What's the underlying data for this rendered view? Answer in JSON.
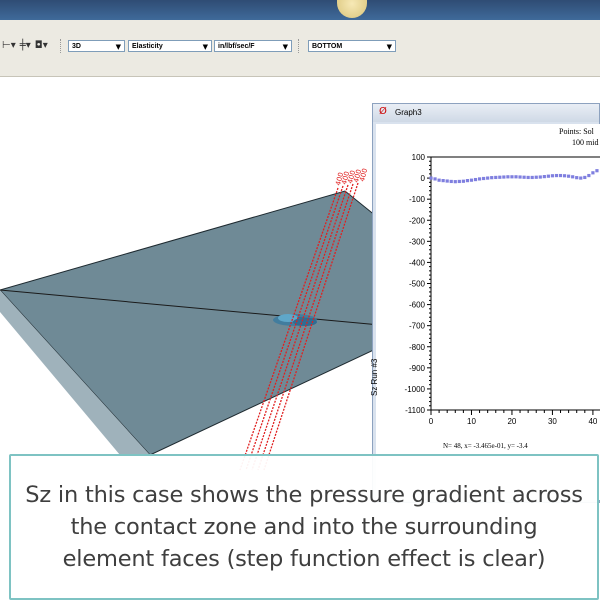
{
  "toolbar": {
    "view_mode": "3D",
    "result_type": "Elasticity",
    "units": "in/lbf/sec/F",
    "surface": "BOTTOM",
    "icons": [
      "lock-icon",
      "axis-icon",
      "camera-icon"
    ]
  },
  "graph_window": {
    "title": "Graph3",
    "info_line1": "Points: Sol",
    "info_line2": "100 mid",
    "stat_line": "N=   48, x= -3.465e-01, y= -3.4",
    "chart_data": {
      "type": "scatter",
      "ylabel": "Sz  Run #3",
      "xlabel": "",
      "y_ticks": [
        100,
        0,
        -100,
        -200,
        -300,
        -400,
        -500,
        -600,
        -700,
        -800,
        -900,
        -1000,
        -1100
      ],
      "x_ticks": [
        0,
        10,
        20,
        30,
        40
      ],
      "ylim": [
        -1100,
        100
      ],
      "xlim": [
        0,
        42
      ],
      "series": [
        {
          "color": "#7f7fdf",
          "points": [
            [
              0,
              0
            ],
            [
              1,
              -4
            ],
            [
              2,
              -10
            ],
            [
              3,
              -12
            ],
            [
              4,
              -14
            ],
            [
              5,
              -16
            ],
            [
              6,
              -17
            ],
            [
              7,
              -16
            ],
            [
              8,
              -15
            ],
            [
              9,
              -12
            ],
            [
              10,
              -10
            ],
            [
              11,
              -7
            ],
            [
              12,
              -4
            ],
            [
              13,
              -2
            ],
            [
              14,
              0
            ],
            [
              15,
              2
            ],
            [
              16,
              3
            ],
            [
              17,
              4
            ],
            [
              18,
              5
            ],
            [
              19,
              6
            ],
            [
              20,
              6
            ],
            [
              21,
              6
            ],
            [
              22,
              5
            ],
            [
              23,
              4
            ],
            [
              24,
              3
            ],
            [
              25,
              3
            ],
            [
              26,
              4
            ],
            [
              27,
              5
            ],
            [
              28,
              7
            ],
            [
              29,
              9
            ],
            [
              30,
              11
            ],
            [
              31,
              12
            ],
            [
              32,
              12
            ],
            [
              33,
              11
            ],
            [
              34,
              9
            ],
            [
              35,
              6
            ],
            [
              36,
              2
            ],
            [
              37,
              0
            ],
            [
              38,
              3
            ],
            [
              39,
              12
            ],
            [
              40,
              25
            ],
            [
              41,
              35
            ]
          ]
        }
      ]
    }
  },
  "caption": {
    "text": "Sz in this case shows the pressure gradient across the contact zone and into the surrounding element faces (step function effect is clear)"
  },
  "scene": {
    "plate_color": "#6f8a96",
    "probe_color": "#e02020",
    "probe_labels": [
      "400",
      "400",
      "400",
      "400",
      "400"
    ]
  }
}
